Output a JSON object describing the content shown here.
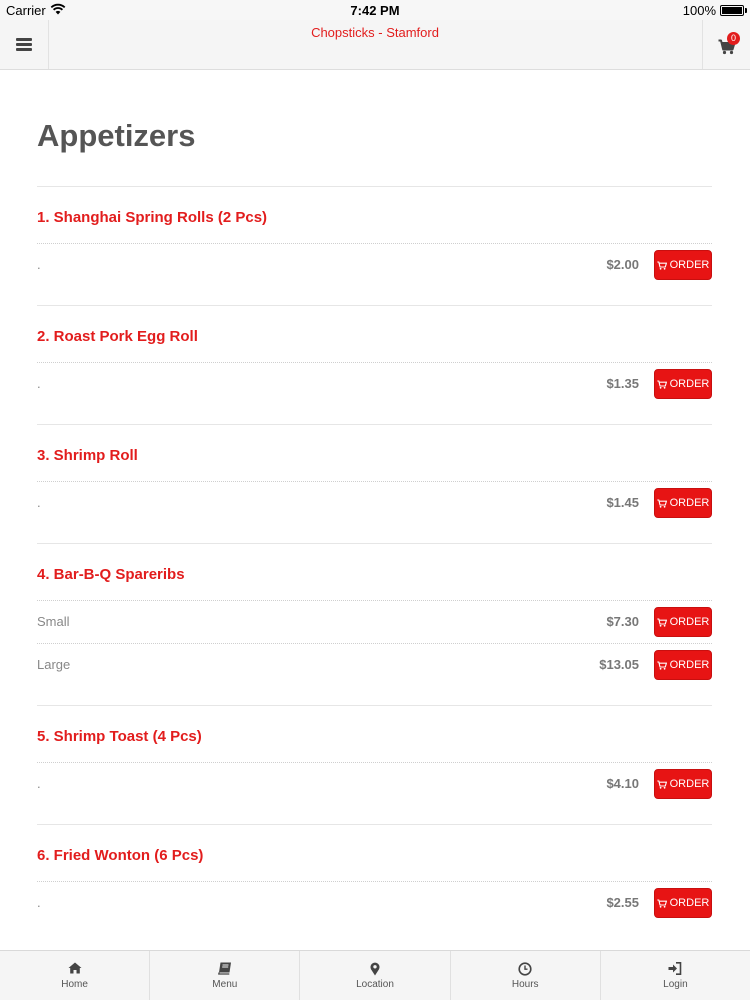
{
  "status_bar": {
    "carrier": "Carrier",
    "time": "7:42 PM",
    "battery": "100%"
  },
  "header": {
    "title": "Chopsticks - Stamford",
    "cart_count": "0"
  },
  "category": {
    "title": "Appetizers"
  },
  "order_label": "ORDER",
  "items": [
    {
      "name": "1. Shanghai Spring Rolls (2 Pcs)",
      "prices": [
        {
          "size": ".",
          "price": "$2.00"
        }
      ]
    },
    {
      "name": "2. Roast Pork Egg Roll",
      "prices": [
        {
          "size": ".",
          "price": "$1.35"
        }
      ]
    },
    {
      "name": "3. Shrimp Roll",
      "prices": [
        {
          "size": ".",
          "price": "$1.45"
        }
      ]
    },
    {
      "name": "4. Bar-B-Q Spareribs",
      "prices": [
        {
          "size": "Small",
          "price": "$7.30"
        },
        {
          "size": "Large",
          "price": "$13.05"
        }
      ]
    },
    {
      "name": "5. Shrimp Toast (4 Pcs)",
      "prices": [
        {
          "size": ".",
          "price": "$4.10"
        }
      ]
    },
    {
      "name": "6. Fried Wonton (6 Pcs)",
      "prices": [
        {
          "size": ".",
          "price": "$2.55"
        }
      ]
    }
  ],
  "tabs": [
    {
      "label": "Home",
      "icon": "home-icon"
    },
    {
      "label": "Menu",
      "icon": "book-icon"
    },
    {
      "label": "Location",
      "icon": "map-marker-icon"
    },
    {
      "label": "Hours",
      "icon": "clock-icon"
    },
    {
      "label": "Login",
      "icon": "sign-in-icon"
    }
  ],
  "colors": {
    "accent": "#e21d1d",
    "button": "#e71414",
    "title": "#555555"
  }
}
